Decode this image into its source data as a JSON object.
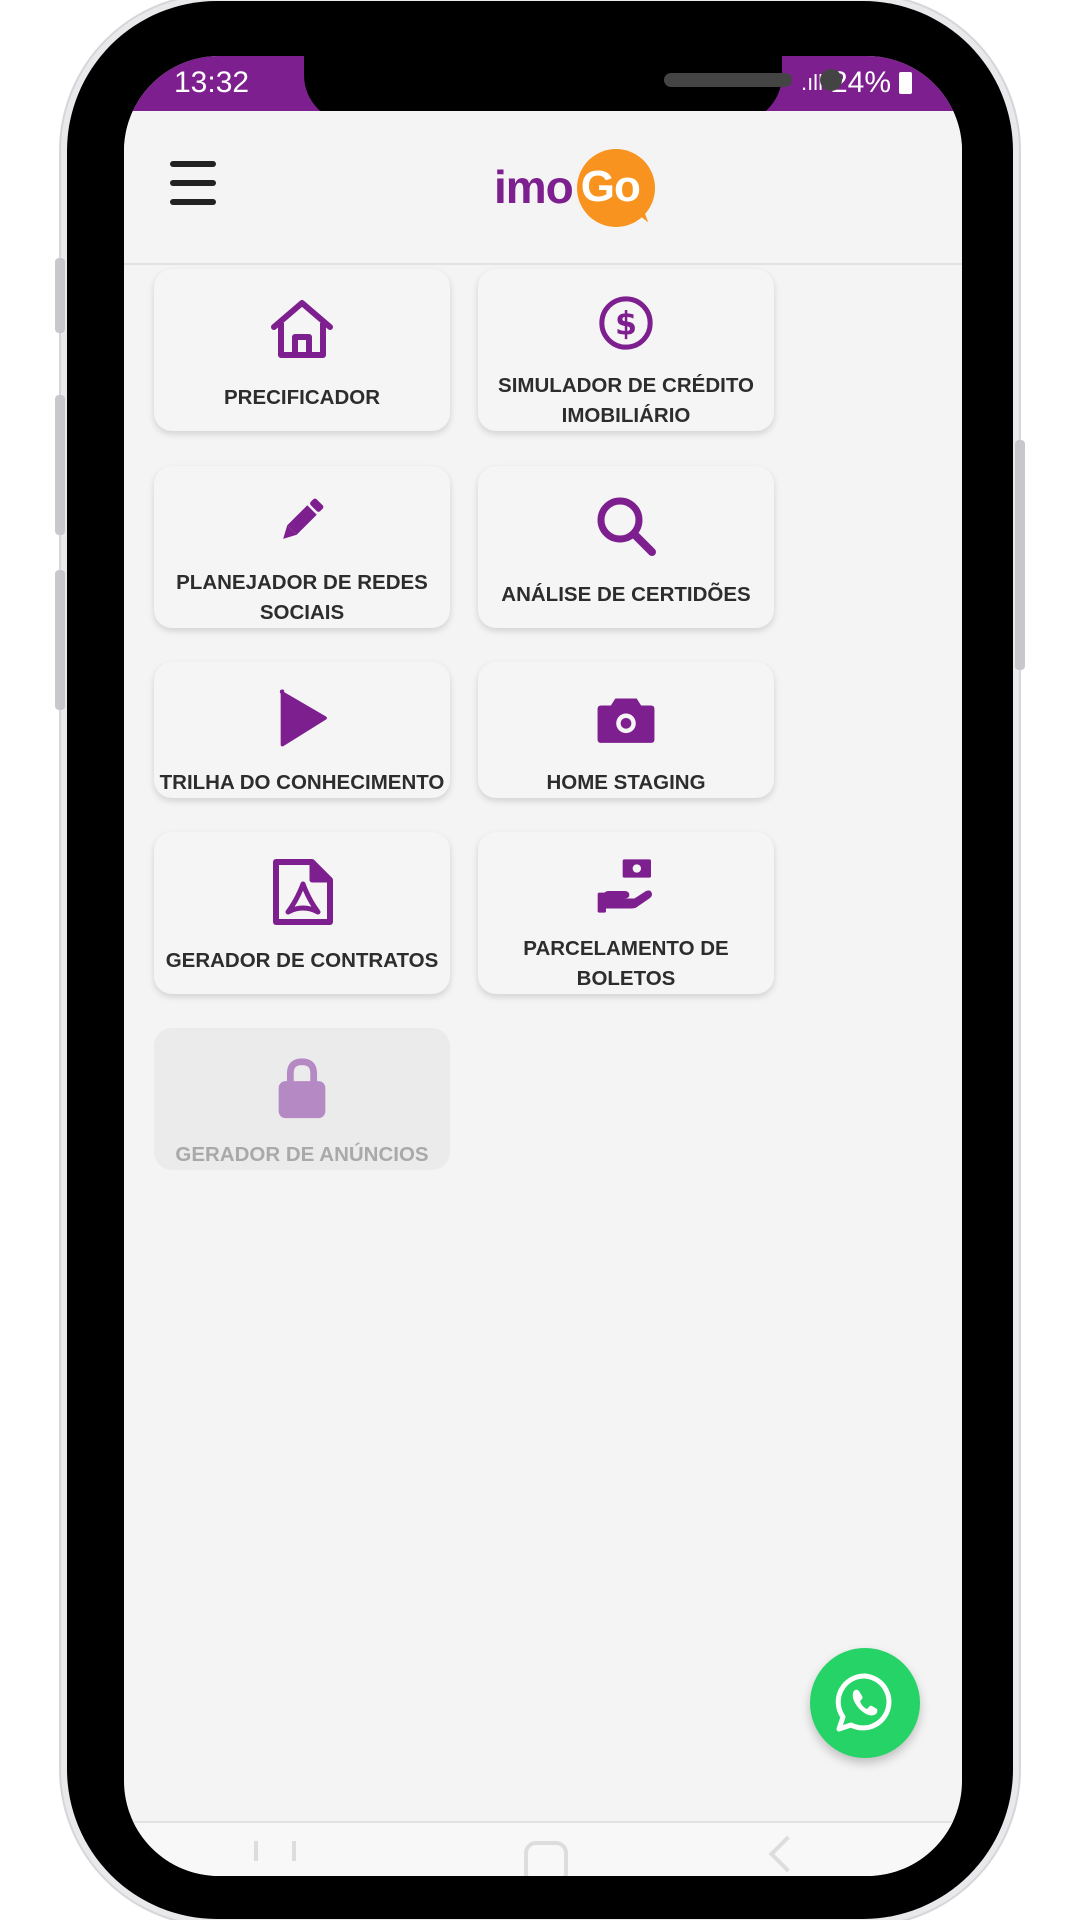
{
  "status_bar": {
    "time": "13:32",
    "battery": "24%"
  },
  "header": {
    "logo_part1": "imo",
    "logo_part2": "Go"
  },
  "colors": {
    "brand_purple": "#7d1f8e",
    "brand_orange": "#f7931e",
    "whatsapp_green": "#25d366"
  },
  "menu": [
    {
      "label": "PRECIFICADOR",
      "icon": "home-icon",
      "enabled": true
    },
    {
      "label": "SIMULADOR DE CRÉDITO IMOBILIÁRIO",
      "icon": "dollar-icon",
      "enabled": true
    },
    {
      "label": "PLANEJADOR DE REDES SOCIAIS",
      "icon": "pencil-icon",
      "enabled": true
    },
    {
      "label": "ANÁLISE DE CERTIDÕES",
      "icon": "search-icon",
      "enabled": true
    },
    {
      "label": "TRILHA DO CONHECIMENTO",
      "icon": "play-icon",
      "enabled": true
    },
    {
      "label": "HOME STAGING",
      "icon": "camera-icon",
      "enabled": true
    },
    {
      "label": "GERADOR DE CONTRATOS",
      "icon": "pdf-document-icon",
      "enabled": true
    },
    {
      "label": "PARCELAMENTO DE BOLETOS",
      "icon": "hand-money-icon",
      "enabled": true
    },
    {
      "label": "GERADOR DE ANÚNCIOS",
      "icon": "lock-icon",
      "enabled": false
    }
  ],
  "fab": {
    "icon": "whatsapp-icon"
  }
}
